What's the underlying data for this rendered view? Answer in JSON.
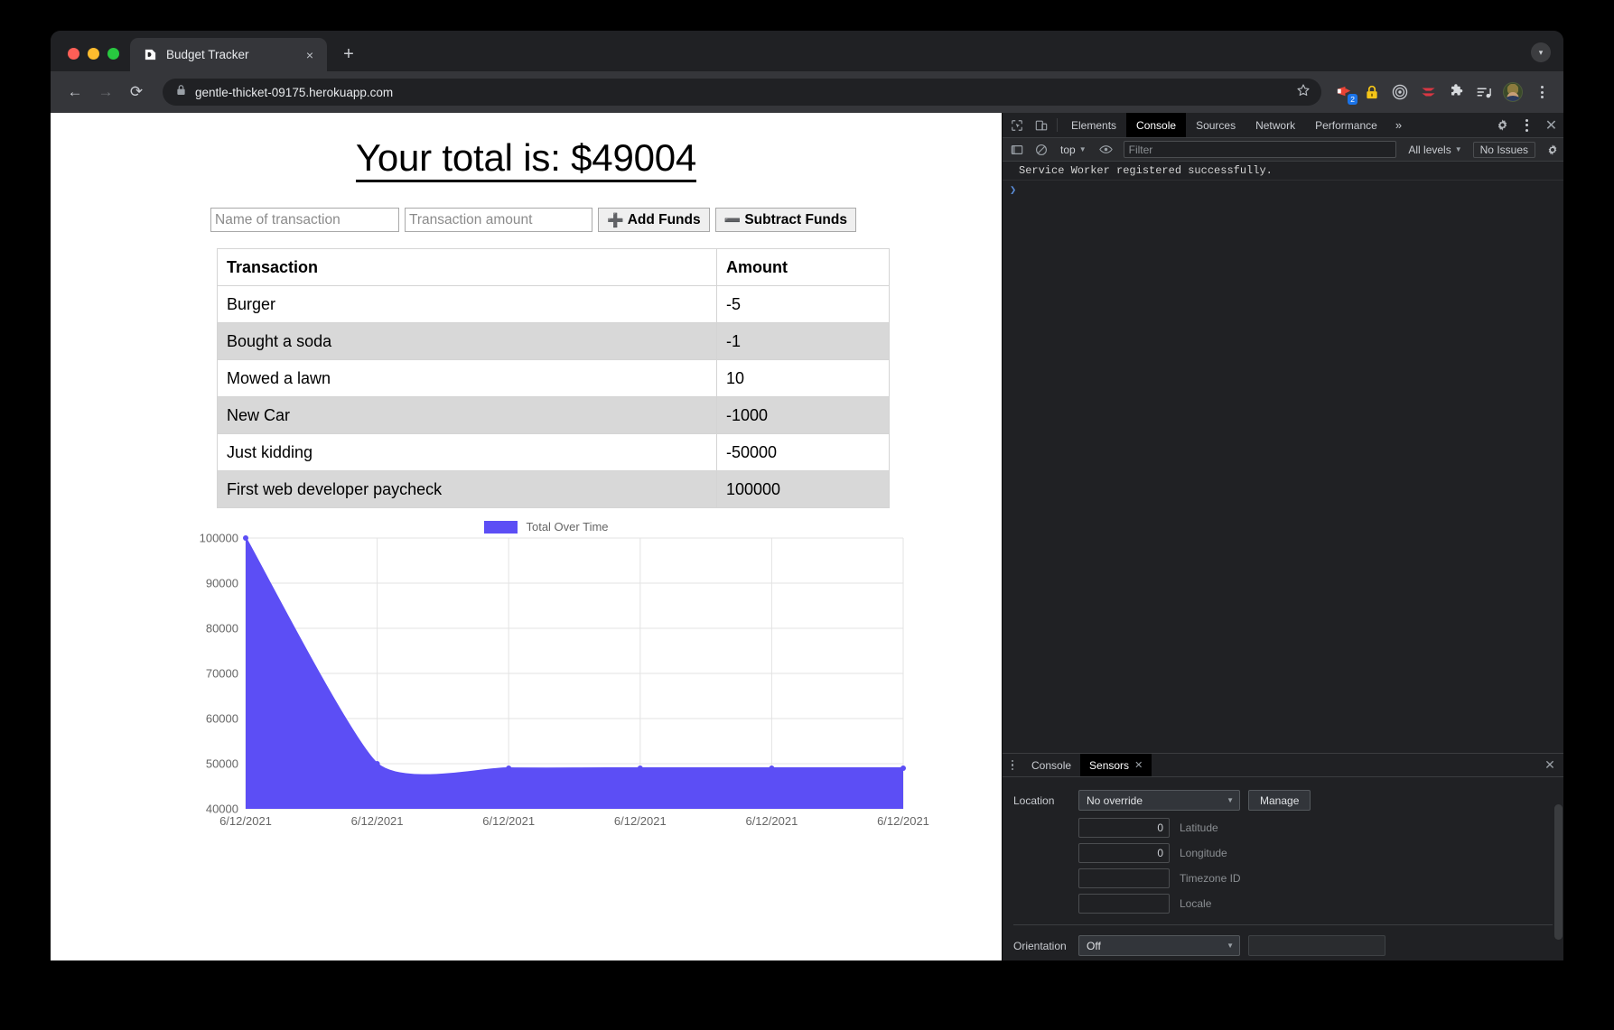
{
  "window": {
    "traffic_lights": [
      "close",
      "minimize",
      "maximize"
    ],
    "tab": {
      "title": "Budget Tracker",
      "favicon": "budget-favicon",
      "close_label": "×"
    },
    "new_tab_label": "+",
    "profile_menu_label": "▾"
  },
  "omnibox": {
    "back_label": "←",
    "forward_label": "→",
    "reload_label": "⟳",
    "url": "gentle-thicket-09175.herokuapp.com",
    "lock_icon": "lock-icon",
    "star_icon": "bookmark-star-icon",
    "extensions": [
      {
        "name": "media-router-icon",
        "badge": "2"
      },
      {
        "name": "password-lock-icon",
        "badge": ""
      },
      {
        "name": "target-recorder-icon",
        "badge": ""
      },
      {
        "name": "express-vpn-icon",
        "badge": ""
      },
      {
        "name": "puzzle-extensions-icon",
        "badge": ""
      },
      {
        "name": "reading-list-icon",
        "badge": ""
      }
    ],
    "avatar_name": "profile-avatar",
    "menu_label": "kebab-menu"
  },
  "page": {
    "total_prefix": "Your total is: $",
    "total_value": "49004",
    "total_heading": "Your total is: $49004",
    "form": {
      "name_placeholder": "Name of transaction",
      "name_value": "",
      "amount_placeholder": "Transaction amount",
      "amount_value": "",
      "add_symbol": "➕",
      "add_label": "Add Funds",
      "subtract_symbol": "➖",
      "subtract_label": "Subtract Funds"
    },
    "table": {
      "columns": [
        "Transaction",
        "Amount"
      ],
      "rows": [
        {
          "name": "Burger",
          "amount": "-5"
        },
        {
          "name": "Bought a soda",
          "amount": "-1"
        },
        {
          "name": "Mowed a lawn",
          "amount": "10"
        },
        {
          "name": "New Car",
          "amount": "-1000"
        },
        {
          "name": "Just kidding",
          "amount": "-50000"
        },
        {
          "name": "First web developer paycheck",
          "amount": "100000"
        }
      ]
    }
  },
  "chart_data": {
    "type": "area",
    "title": "",
    "legend": [
      {
        "name": "Total Over Time",
        "color": "#5c4ef5"
      }
    ],
    "legend_position": "top-center",
    "x": [
      "6/12/2021",
      "6/12/2021",
      "6/12/2021",
      "6/12/2021",
      "6/12/2021",
      "6/12/2021"
    ],
    "categories": [
      "6/12/2021",
      "6/12/2021",
      "6/12/2021",
      "6/12/2021",
      "6/12/2021",
      "6/12/2021"
    ],
    "series": [
      {
        "name": "Total Over Time",
        "values": [
          100000,
          50000,
          49000,
          49010,
          49005,
          49004
        ]
      }
    ],
    "values": [
      100000,
      50000,
      49000,
      49010,
      49005,
      49004
    ],
    "ylabel": "",
    "xlabel": "",
    "ylim": [
      40000,
      100000
    ],
    "yticks": [
      "100000",
      "90000",
      "80000",
      "70000",
      "60000",
      "50000",
      "40000"
    ],
    "ytick_values": [
      100000,
      90000,
      80000,
      70000,
      60000,
      50000,
      40000
    ],
    "grid": true,
    "fill_color": "#5c4ef5",
    "line_color": "#5c4ef5"
  },
  "devtools": {
    "inspect_icon": "inspect-element-icon",
    "device_icon": "device-toolbar-icon",
    "tabs": [
      {
        "label": "Elements",
        "active": false
      },
      {
        "label": "Console",
        "active": true
      },
      {
        "label": "Sources",
        "active": false
      },
      {
        "label": "Network",
        "active": false
      },
      {
        "label": "Performance",
        "active": false
      }
    ],
    "more_tabs_label": "»",
    "settings_icon": "gear-icon",
    "kebab_icon": "kebab-menu-icon",
    "close_label": "✕",
    "console_toolbar": {
      "sidebar_label": "show-console-sidebar",
      "clear_label": "clear-console",
      "context": "top",
      "eye_label": "live-expression",
      "filter_placeholder": "Filter",
      "filter_value": "",
      "levels": "All levels",
      "issues": "No Issues",
      "settings_icon": "gear-icon"
    },
    "console_messages": [
      "Service Worker registered successfully."
    ],
    "prompt_arrow": "❯",
    "drawer": {
      "tabs": [
        {
          "label": "Console",
          "active": false,
          "closable": false
        },
        {
          "label": "Sensors",
          "active": true,
          "closable": true
        }
      ],
      "close_label": "✕",
      "sensors": {
        "location_label": "Location",
        "location_value": "No override",
        "manage_label": "Manage",
        "fields": [
          {
            "name": "Latitude",
            "value": "0"
          },
          {
            "name": "Longitude",
            "value": "0"
          },
          {
            "name": "Timezone ID",
            "value": ""
          },
          {
            "name": "Locale",
            "value": ""
          }
        ],
        "orientation_label": "Orientation",
        "orientation_value": "Off"
      }
    }
  }
}
